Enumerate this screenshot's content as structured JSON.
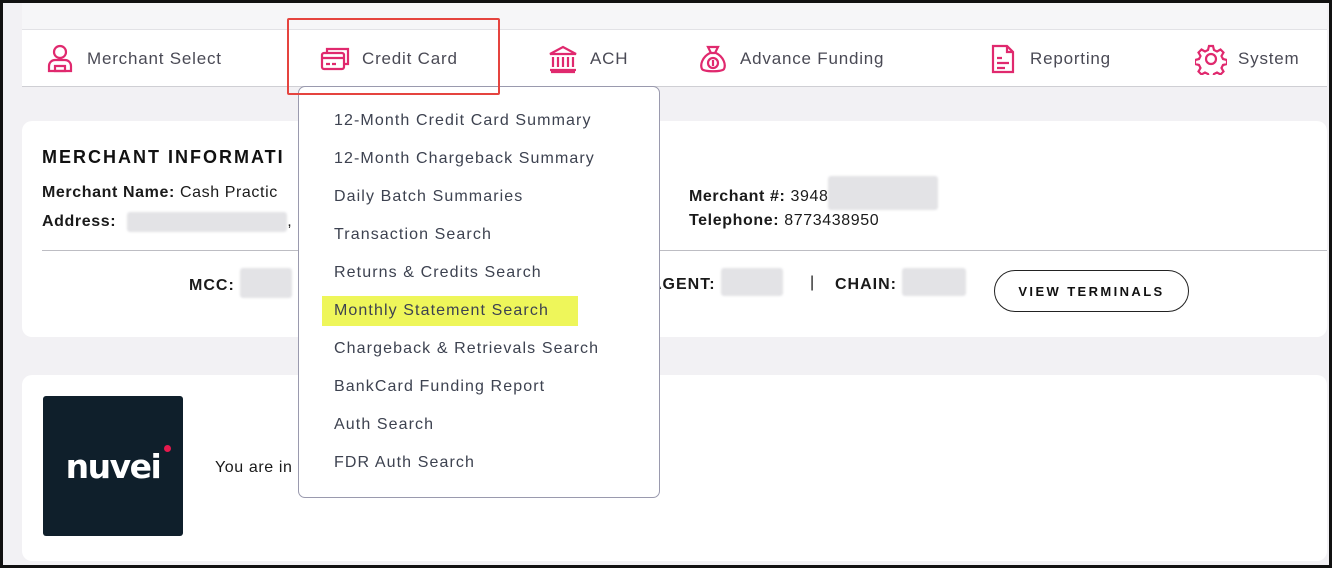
{
  "accent_color": "#e0296e",
  "nav": {
    "items": [
      {
        "label": "Merchant Select",
        "icon": "user-icon"
      },
      {
        "label": "Credit Card",
        "icon": "credit-card-icon"
      },
      {
        "label": "ACH",
        "icon": "bank-icon"
      },
      {
        "label": "Advance Funding",
        "icon": "money-bag-icon"
      },
      {
        "label": "Reporting",
        "icon": "report-document-icon"
      },
      {
        "label": "System",
        "icon": "gear-icon"
      }
    ]
  },
  "merchant_info": {
    "title": "MERCHANT  INFORMATI",
    "name_label": "Merchant Name:",
    "name_value": "Cash Practic",
    "address_label": "Address:",
    "address_suffix": ",",
    "number_label": "Merchant #:",
    "number_value": "3948",
    "telephone_label": "Telephone:",
    "telephone_value": "8773438950",
    "mcc_label": "MCC:",
    "agent_label": "AGENT:",
    "separator": "|",
    "chain_label": "CHAIN:",
    "view_terminals_label": "VIEW TERMINALS"
  },
  "welcome": {
    "logo_text": "nuvei",
    "text": "You are in"
  },
  "dropdown": {
    "items": [
      "12-Month Credit Card Summary",
      "12-Month Chargeback Summary",
      "Daily Batch Summaries",
      "Transaction Search",
      "Returns & Credits Search",
      "Monthly Statement Search",
      "Chargeback & Retrievals Search",
      "BankCard Funding Report",
      "Auth Search",
      "FDR Auth Search"
    ],
    "highlighted_item": "Monthly Statement Search"
  }
}
